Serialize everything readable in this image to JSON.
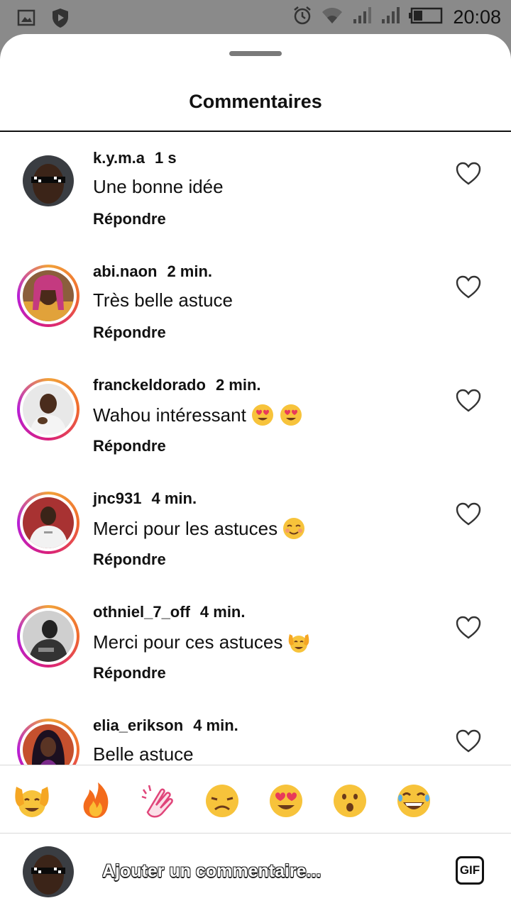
{
  "status_bar": {
    "time": "20:08",
    "icons": [
      "gallery-icon",
      "shield-play-icon",
      "alarm-icon",
      "wifi-icon",
      "signal-icon",
      "signal-icon",
      "battery-icon"
    ]
  },
  "sheet": {
    "title": "Commentaires"
  },
  "comments": [
    {
      "username": "k.y.m.a",
      "time": "1 s",
      "text": "Une bonne idée",
      "emojis": [],
      "reply_label": "Répondre",
      "ring": false
    },
    {
      "username": "abi.naon",
      "time": "2 min.",
      "text": "Très belle astuce",
      "emojis": [],
      "reply_label": "Répondre",
      "ring": true
    },
    {
      "username": "franckeldorado",
      "time": "2 min.",
      "text": "Wahou intéressant",
      "emojis": [
        "heart-eyes-emoji",
        "heart-eyes-emoji"
      ],
      "reply_label": "Répondre",
      "ring": true
    },
    {
      "username": "jnc931",
      "time": "4 min.",
      "text": "Merci pour les astuces",
      "emojis": [
        "smiling-eyes-emoji"
      ],
      "reply_label": "Répondre",
      "ring": true
    },
    {
      "username": "othniel_7_off",
      "time": "4 min.",
      "text": "Merci pour ces astuces",
      "emojis": [
        "raising-hands-emoji"
      ],
      "reply_label": "Répondre",
      "ring": true
    },
    {
      "username": "elia_erikson",
      "time": "4 min.",
      "text": "Belle astuce",
      "emojis": [],
      "reply_label": "",
      "ring": true
    }
  ],
  "emoji_bar": [
    "raising-hands-emoji",
    "fire-emoji",
    "clapping-emoji",
    "sad-emoji",
    "heart-eyes-emoji",
    "surprised-emoji",
    "laughing-emoji"
  ],
  "composer": {
    "placeholder": "Ajouter un commentaire...",
    "gif_label": "GIF"
  }
}
